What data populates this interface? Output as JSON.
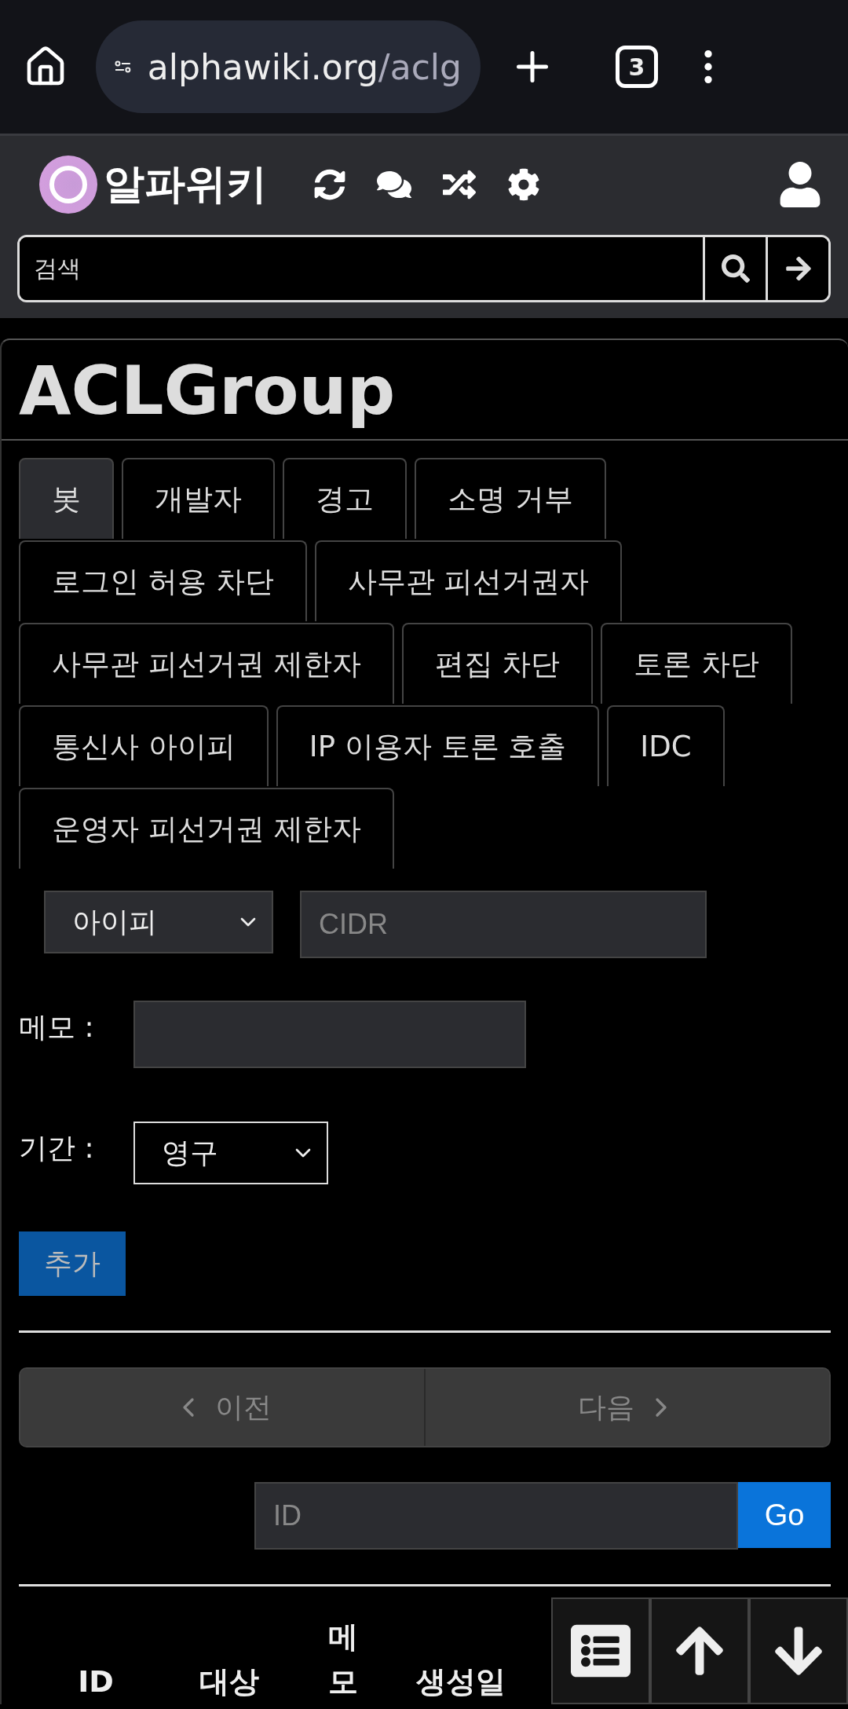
{
  "browser": {
    "url_host": "alphawiki.org",
    "url_path": "/aclg",
    "tab_count": "3"
  },
  "site": {
    "name": "알파위키",
    "search": {
      "placeholder": "검색"
    }
  },
  "page": {
    "title": "ACLGroup"
  },
  "tabs": [
    {
      "label": "봇",
      "selected": true
    },
    {
      "label": "개발자",
      "selected": false
    },
    {
      "label": "경고",
      "selected": false
    },
    {
      "label": "소명 거부",
      "selected": false
    },
    {
      "label": "로그인 허용 차단",
      "selected": false
    },
    {
      "label": "사무관 피선거권자",
      "selected": false
    },
    {
      "label": "사무관 피선거권 제한자",
      "selected": false
    },
    {
      "label": "편집 차단",
      "selected": false
    },
    {
      "label": "토론 차단",
      "selected": false
    },
    {
      "label": "통신사 아이피",
      "selected": false
    },
    {
      "label": "IP 이용자 토론 호출",
      "selected": false
    },
    {
      "label": "IDC",
      "selected": false
    },
    {
      "label": "운영자 피선거권 제한자",
      "selected": false
    }
  ],
  "form": {
    "type_select": "아이피",
    "cidr": {
      "placeholder": "CIDR"
    },
    "memo_label": "메모 :",
    "period_label": "기간 :",
    "period_select": "영구",
    "add_button": "추가"
  },
  "pager": {
    "prev": "이전",
    "next": "다음",
    "prev_disabled": true,
    "next_disabled": true
  },
  "id_jump": {
    "placeholder": "ID",
    "button": "Go"
  },
  "table": {
    "columns": [
      "ID",
      "대상",
      "메\n모",
      "생성일"
    ]
  }
}
